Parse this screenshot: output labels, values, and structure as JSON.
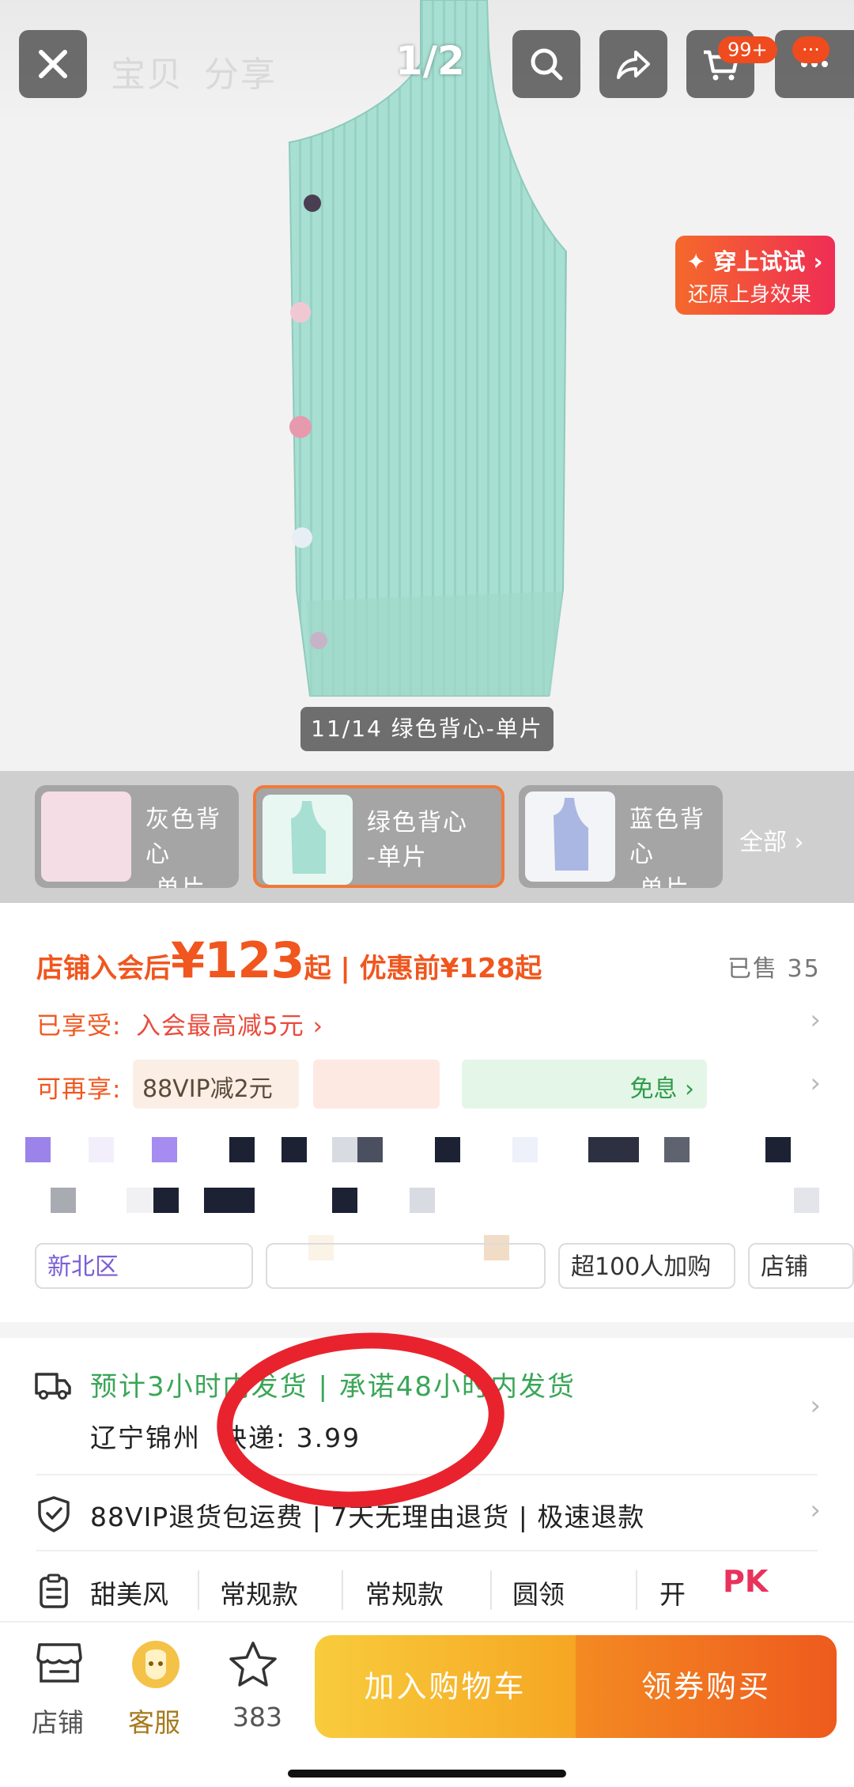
{
  "hero": {
    "tab_item": "宝贝",
    "tab_share": "分享",
    "counter": "1/2",
    "cart_badge": "99+",
    "more_badge": "···",
    "tryon_title": "✦ 穿上试试 ›",
    "tryon_sub": "还原上身效果",
    "caption": "11/14 绿色背心-单片",
    "icons": [
      "close-icon",
      "search-icon",
      "share-icon",
      "cart-icon",
      "more-icon"
    ]
  },
  "variants": {
    "items": [
      {
        "line1": "灰色背心",
        "line2": "-单片"
      },
      {
        "line1": "绿色背心",
        "line2": "-单片"
      },
      {
        "line1": "蓝色背心",
        "line2": "-单片"
      }
    ],
    "all_label": "全部 ›"
  },
  "price": {
    "member_label": "店铺入会后",
    "member_price": "¥123",
    "member_suffix": "起",
    "divider": " | ",
    "original_label": "优惠前",
    "original_price": "¥128起",
    "sold": "已售 35"
  },
  "promos": {
    "enjoyed_label": "已享受:",
    "enjoyed_text": "入会最高减5元 ›",
    "more_label": "可再享:",
    "chip_88vip": "88VIP减2元",
    "chip_interest_free": "免息 ›"
  },
  "tags": {
    "chips": [
      "新北区",
      "超100人加购",
      "店铺"
    ]
  },
  "delivery": {
    "eta": "预计3小时内发货 | 承诺48小时内发货",
    "location": "辽宁锦州",
    "courier": "快递: 3.99",
    "returns": "88VIP退货包运费 | 7天无理由退货 | 极速退款"
  },
  "attributes": {
    "items": [
      "甜美风",
      "常规款",
      "常规款",
      "圆领",
      "开"
    ],
    "pk": "PK"
  },
  "bottombar": {
    "shop": "店铺",
    "service": "客服",
    "favorites": "383",
    "add_to_cart": "加入购物车",
    "buy": "领券购买"
  },
  "colors": {
    "accent": "#f0561e",
    "green": "#3aa657",
    "annotation": "#e8232e"
  }
}
